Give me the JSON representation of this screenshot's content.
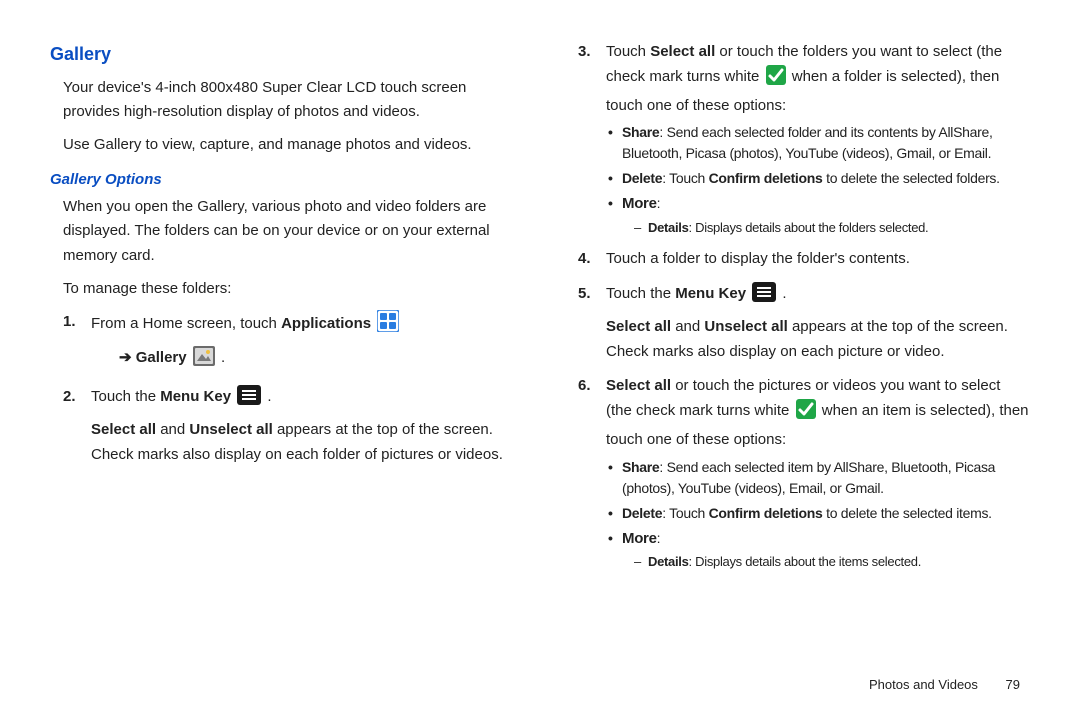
{
  "left": {
    "h1": "Gallery",
    "p1": "Your device's 4-inch 800x480 Super Clear LCD touch screen provides high-resolution display of photos and videos.",
    "p2": "Use Gallery to view, capture, and manage photos and videos.",
    "h2": "Gallery Options",
    "p3": "When you open the Gallery, various photo and video folders are displayed. The folders can be on your device or on your external memory card.",
    "p4": "To manage these folders:",
    "s1a": "From a Home screen, touch ",
    "s1b": "Applications",
    "s1c": "Gallery",
    "arrow": "➔",
    "s1dot": " .",
    "s2a": "Touch the ",
    "s2b": "Menu Key",
    "s2dot": " .",
    "s2p": "Select all",
    "s2p2": " and ",
    "s2p3": "Unselect all",
    "s2p4": " appears at the top of the screen. Check marks also display on each folder of pictures or videos."
  },
  "right": {
    "s3a": "Touch ",
    "s3b": "Select all",
    "s3c": " or touch the folders you want to select (the check mark turns white ",
    "s3d": " when a folder is selected), then touch one of these options:",
    "b3_share_l": "Share",
    "b3_share_t": ": Send each selected folder and its contents by AllShare, Bluetooth, Picasa (photos), YouTube (videos), Gmail, or Email.",
    "b3_delete_l": "Delete",
    "b3_delete_t1": ": Touch ",
    "b3_delete_t2": "Confirm deletions",
    "b3_delete_t3": " to delete the selected folders.",
    "b3_more_l": "More",
    "b3_more_colon": ":",
    "d3_details_l": "Details",
    "d3_details_t": ": Displays details about the folders selected.",
    "s4": "Touch a folder to display the folder's contents.",
    "s5a": "Touch the ",
    "s5b": "Menu Key",
    "s5dot": " .",
    "s5p1": "Select all",
    "s5p2": " and ",
    "s5p3": "Unselect all",
    "s5p4": " appears at the top of the screen. Check marks also display on each picture or video.",
    "s6a": "Select all",
    "s6b": " or touch the pictures or videos you want to select (the check mark turns white ",
    "s6c": " when an item is selected), then touch one of these options:",
    "b6_share_l": "Share",
    "b6_share_t": ": Send each selected item by AllShare, Bluetooth, Picasa (photos), YouTube (videos), Email, or Gmail.",
    "b6_delete_l": "Delete",
    "b6_delete_t1": ": Touch ",
    "b6_delete_t2": "Confirm deletions",
    "b6_delete_t3": " to delete the selected items.",
    "b6_more_l": "More",
    "b6_more_colon": ":",
    "d6_details_l": "Details",
    "d6_details_t": ": Displays details about the items selected."
  },
  "footer": {
    "section": "Photos and Videos",
    "page": "79"
  }
}
